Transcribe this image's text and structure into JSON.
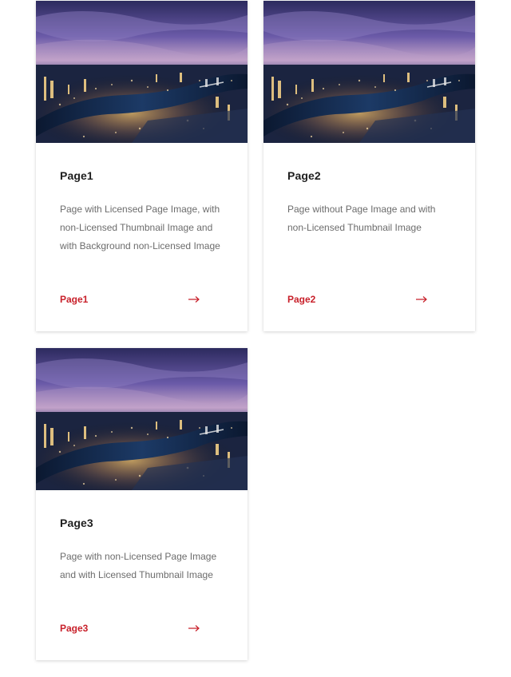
{
  "colors": {
    "accent": "#c8202a",
    "title": "#1f1f1f",
    "text": "#6c6c6c"
  },
  "cards": [
    {
      "title": "Page1",
      "description": "Page with Licensed Page Image, with non-Licensed Thumbnail Image and with Background non-Licensed Image",
      "link_label": "Page1",
      "icon": "arrow-right-icon"
    },
    {
      "title": "Page2",
      "description": "Page without Page Image and with non-Licensed Thumbnail Image",
      "link_label": "Page2",
      "icon": "arrow-right-icon"
    },
    {
      "title": "Page3",
      "description": "Page with non-Licensed Page Image and with Licensed Thumbnail Image",
      "link_label": "Page3",
      "icon": "arrow-right-icon"
    }
  ]
}
